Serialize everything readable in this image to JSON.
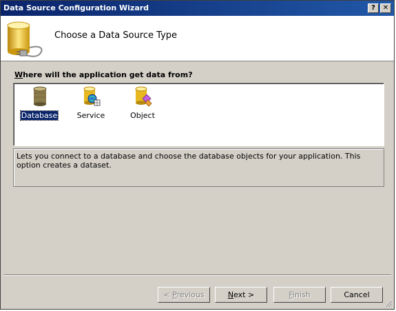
{
  "window": {
    "title": "Data Source Configuration Wizard"
  },
  "header": {
    "title": "Choose a Data Source Type"
  },
  "section": {
    "label_underline": "W",
    "label_rest": "here will the application get data from?"
  },
  "types": [
    {
      "label": "Database",
      "icon": "database-icon",
      "selected": true
    },
    {
      "label": "Service",
      "icon": "service-icon",
      "selected": false
    },
    {
      "label": "Object",
      "icon": "object-icon",
      "selected": false
    }
  ],
  "description": "Lets you connect to a database and choose the database objects for your application. This option creates a dataset.",
  "buttons": {
    "previous": {
      "prefix": "< ",
      "underline": "P",
      "rest": "revious"
    },
    "next": {
      "underline": "N",
      "rest": "ext >"
    },
    "finish": {
      "underline": "F",
      "rest": "inish"
    },
    "cancel": "Cancel"
  },
  "colors": {
    "title_bar": "#0a246a",
    "selection": "#0a246a",
    "face": "#d4d0c8",
    "database_gold": "#d6a51c"
  }
}
